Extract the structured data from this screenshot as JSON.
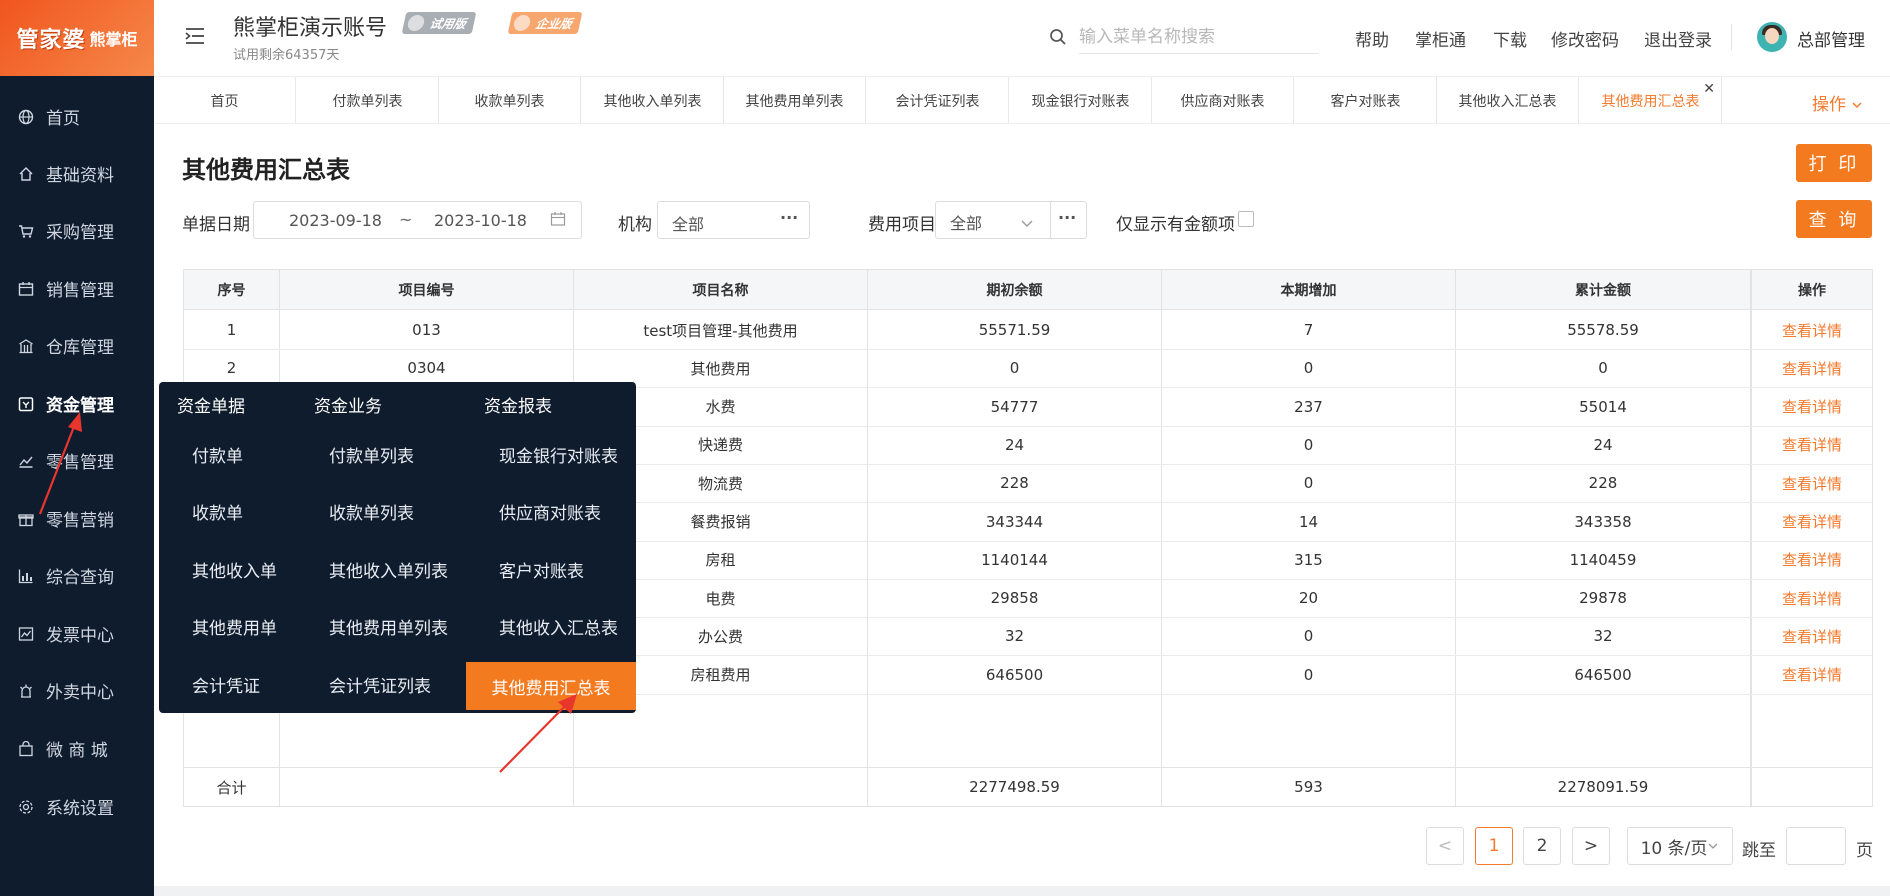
{
  "logo": {
    "main": "管家婆",
    "sub": "熊掌柜"
  },
  "sidebar": {
    "items": [
      {
        "label": "首页",
        "icon": "globe-icon"
      },
      {
        "label": "基础资料",
        "icon": "home-icon"
      },
      {
        "label": "采购管理",
        "icon": "cart-icon"
      },
      {
        "label": "销售管理",
        "icon": "calendar-icon"
      },
      {
        "label": "仓库管理",
        "icon": "warehouse-icon"
      },
      {
        "label": "资金管理",
        "icon": "wallet-icon"
      },
      {
        "label": "零售管理",
        "icon": "bar-chart-icon"
      },
      {
        "label": "零售营销",
        "icon": "gift-icon"
      },
      {
        "label": "综合查询",
        "icon": "stats-icon"
      },
      {
        "label": "发票中心",
        "icon": "trend-icon"
      },
      {
        "label": "外卖中心",
        "icon": "delivery-icon"
      },
      {
        "label": "微 商 城",
        "icon": "bag-icon"
      },
      {
        "label": "系统设置",
        "icon": "gear-icon"
      }
    ],
    "active_index": 5
  },
  "header": {
    "account_name": "熊掌柜演示账号",
    "trial_badge": "试用版",
    "enterprise_badge": "企业版",
    "trial_left": "试用剩余64357天",
    "search_placeholder": "输入菜单名称搜索",
    "links": {
      "help": "帮助",
      "app": "掌柜通",
      "download": "下载",
      "password": "修改密码",
      "logout": "退出登录"
    },
    "user": "总部管理"
  },
  "tabs": [
    "首页",
    "付款单列表",
    "收款单列表",
    "其他收入单列表",
    "其他费用单列表",
    "会计凭证列表",
    "现金银行对账表",
    "供应商对账表",
    "客户对账表",
    "其他收入汇总表",
    "其他费用汇总表"
  ],
  "tab_active_index": 10,
  "tab_ops": "操作",
  "page": {
    "title": "其他费用汇总表",
    "print_button": "打 印",
    "query_button": "查 询"
  },
  "filters": {
    "date_label": "单据日期",
    "date_from": "2023-09-18",
    "date_sep": "~",
    "date_to": "2023-10-18",
    "org_label": "机构",
    "org_value": "全部",
    "expense_label": "费用项目",
    "expense_value": "全部",
    "ellipsis": "···",
    "only_amount_label": "仅显示有金额项"
  },
  "table": {
    "headers": [
      "序号",
      "项目编号",
      "项目名称",
      "期初余额",
      "本期增加",
      "累计金额",
      "操作"
    ],
    "rows": [
      [
        "1",
        "013",
        "test项目管理-其他费用",
        "55571.59",
        "7",
        "55578.59",
        "查看详情"
      ],
      [
        "2",
        "0304",
        "其他费用",
        "0",
        "0",
        "0",
        "查看详情"
      ],
      [
        "",
        "",
        "水费",
        "54777",
        "237",
        "55014",
        "查看详情"
      ],
      [
        "",
        "",
        "快递费",
        "24",
        "0",
        "24",
        "查看详情"
      ],
      [
        "",
        "",
        "物流费",
        "228",
        "0",
        "228",
        "查看详情"
      ],
      [
        "",
        "",
        "餐费报销",
        "343344",
        "14",
        "343358",
        "查看详情"
      ],
      [
        "",
        "",
        "房租",
        "1140144",
        "315",
        "1140459",
        "查看详情"
      ],
      [
        "",
        "",
        "电费",
        "29858",
        "20",
        "29878",
        "查看详情"
      ],
      [
        "",
        "",
        "办公费",
        "32",
        "0",
        "32",
        "查看详情"
      ],
      [
        "",
        "",
        "房租费用",
        "646500",
        "0",
        "646500",
        "查看详情"
      ]
    ],
    "total": {
      "label": "合计",
      "opening": "2277498.59",
      "increase": "593",
      "cumulative": "2278091.59"
    }
  },
  "popup": {
    "headers": [
      "资金单据",
      "资金业务",
      "资金报表"
    ],
    "col1": [
      "付款单",
      "收款单",
      "其他收入单",
      "其他费用单",
      "会计凭证"
    ],
    "col2": [
      "付款单列表",
      "收款单列表",
      "其他收入单列表",
      "其他费用单列表",
      "会计凭证列表"
    ],
    "col3": [
      "现金银行对账表",
      "供应商对账表",
      "客户对账表",
      "其他收入汇总表",
      "其他费用汇总表"
    ]
  },
  "pagination": {
    "prev": "<",
    "pages": [
      "1",
      "2"
    ],
    "current": "1",
    "next": ">",
    "page_size": "10 条/页",
    "jump_label": "跳至",
    "page_unit": "页"
  }
}
